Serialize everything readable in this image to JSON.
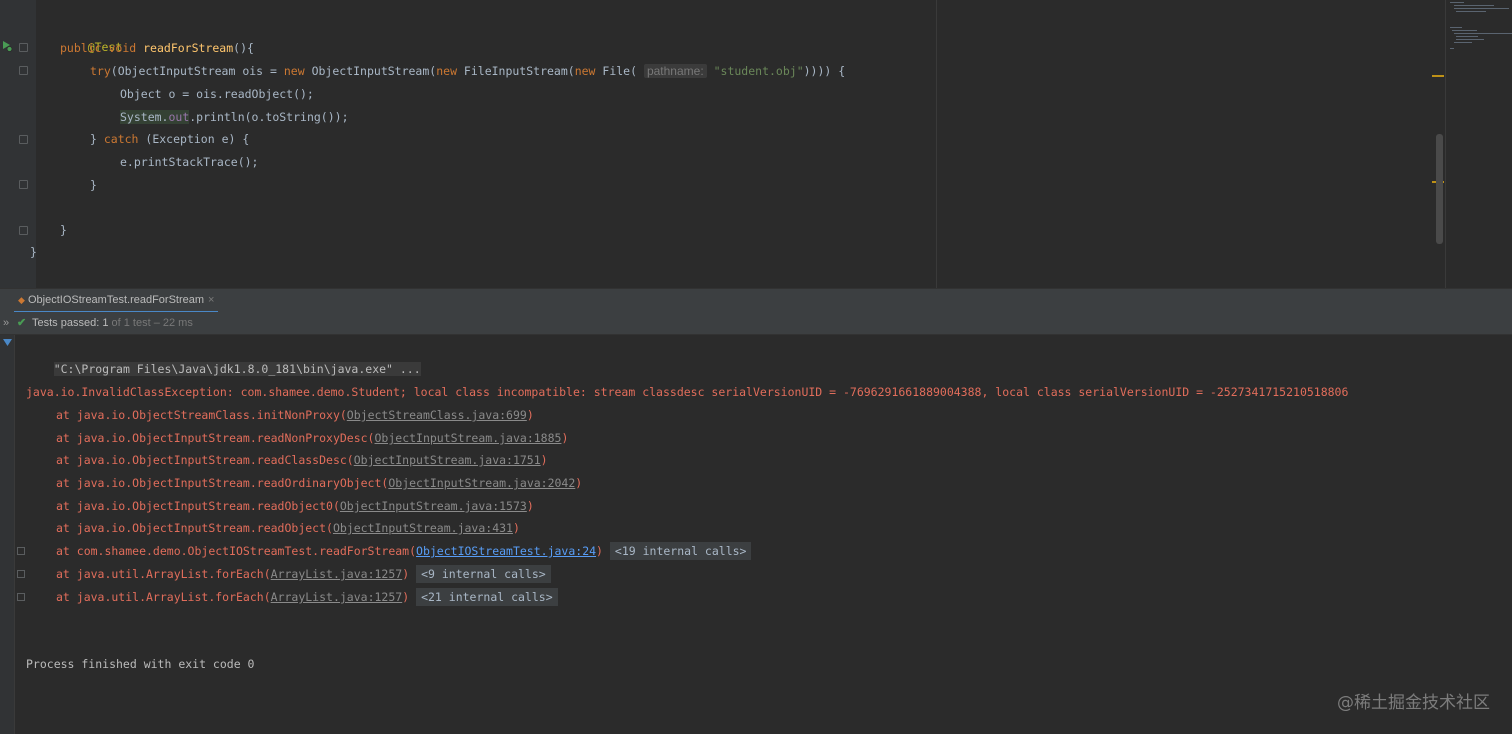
{
  "editor": {
    "lines": [
      {
        "annotation": "@Test"
      },
      {
        "kw_public": "public",
        "kw_void": "void",
        "method": "readForStream",
        "rest": "(){"
      },
      {
        "kw_try": "try",
        "part1": "(ObjectInputStream ois = ",
        "kw_new1": "new",
        "part2": " ObjectInputStream(",
        "kw_new2": "new",
        "part3": " FileInputStream(",
        "kw_new3": "new",
        "part4": " File( ",
        "hint": "pathname:",
        "string": "\"student.obj\"",
        "end": ")))) {"
      },
      {
        "text": "Object o = ois.readObject();"
      },
      {
        "system": "System.",
        "field": "out",
        "rest": ".println(o.toString());"
      },
      {
        "brace": "} ",
        "kw_catch": "catch",
        "rest": " (Exception e) {"
      },
      {
        "text": "e.printStackTrace();"
      },
      {
        "text": "}"
      },
      {
        "text": "}"
      },
      {
        "text": "}"
      }
    ]
  },
  "run_panel": {
    "tab_title": "ObjectIOStreamTest.readForStream",
    "tab_close": "×",
    "status": {
      "label": "Tests passed:",
      "count": "1",
      "detail": "of 1 test – 22 ms"
    },
    "command_line": "\"C:\\Program Files\\Java\\jdk1.8.0_181\\bin\\java.exe\" ...",
    "exception": "java.io.InvalidClassException: com.shamee.demo.Student; local class incompatible: stream classdesc serialVersionUID = -7696291661889004388, local class serialVersionUID = -2527341715210518806",
    "stack": [
      {
        "prefix": "at java.io.ObjectStreamClass.initNonProxy(",
        "link": "ObjectStreamClass.java:699",
        "suffix": ")"
      },
      {
        "prefix": "at java.io.ObjectInputStream.readNonProxyDesc(",
        "link": "ObjectInputStream.java:1885",
        "suffix": ")"
      },
      {
        "prefix": "at java.io.ObjectInputStream.readClassDesc(",
        "link": "ObjectInputStream.java:1751",
        "suffix": ")"
      },
      {
        "prefix": "at java.io.ObjectInputStream.readOrdinaryObject(",
        "link": "ObjectInputStream.java:2042",
        "suffix": ")"
      },
      {
        "prefix": "at java.io.ObjectInputStream.readObject0(",
        "link": "ObjectInputStream.java:1573",
        "suffix": ")"
      },
      {
        "prefix": "at java.io.ObjectInputStream.readObject(",
        "link": "ObjectInputStream.java:431",
        "suffix": ")"
      },
      {
        "prefix": "at com.shamee.demo.ObjectIOStreamTest.readForStream(",
        "link": "ObjectIOStreamTest.java:24",
        "suffix": ")",
        "calls": "<19 internal calls>"
      },
      {
        "prefix": "at java.util.ArrayList.forEach(",
        "link": "ArrayList.java:1257",
        "suffix": ")",
        "calls": "<9 internal calls>"
      },
      {
        "prefix": "at java.util.ArrayList.forEach(",
        "link": "ArrayList.java:1257",
        "suffix": ")",
        "calls": "<21 internal calls>"
      }
    ],
    "finished": "Process finished with exit code 0"
  },
  "watermark": "@稀土掘金技术社区",
  "colors": {
    "keyword": "#cc7832",
    "error": "#e16d5b",
    "link": "#589df6",
    "annotation": "#bbb529",
    "method": "#ffc66d",
    "string": "#6a8759",
    "success": "#499c54"
  }
}
